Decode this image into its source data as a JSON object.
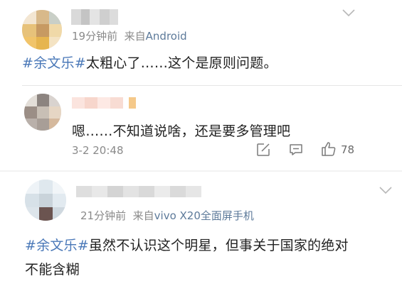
{
  "comments": [
    {
      "time": "19分钟前",
      "source_prefix": "来自",
      "source": "Android",
      "tag": "#余文乐#",
      "text": "太粗心了……这个是原则问题。"
    },
    {
      "text": "嗯……不知道说啥，还是要多管理吧",
      "date": "3-2 20:48",
      "like_count": "78"
    },
    {
      "time": "21分钟前",
      "source_prefix": "来自",
      "source": "vivo X20全面屏手机",
      "tag": "#余文乐#",
      "text_line1": "虽然不认识这个明星，但事关于国家的绝对",
      "text_line2": "不能含糊"
    }
  ],
  "icons": {
    "collapse": "chevron-down-icon",
    "share": "share-icon",
    "reply": "comment-icon",
    "like": "thumbs-up-icon"
  },
  "colors": {
    "topic_link": "#4a78b8",
    "source_link": "#5d7a9a",
    "meta_gray": "#8a8a8a"
  }
}
